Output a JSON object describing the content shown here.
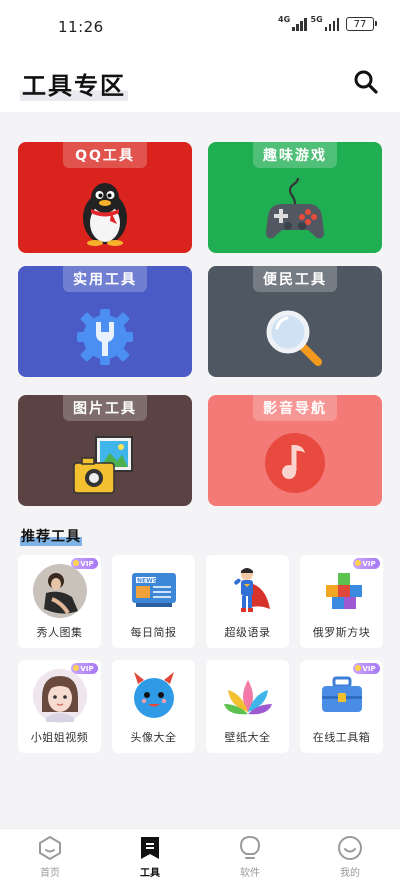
{
  "status": {
    "time": "11:26",
    "sig1": "4G",
    "sig2": "5G",
    "battery": "77"
  },
  "header": {
    "title": "工具专区"
  },
  "cards": [
    {
      "label": "QQ工具",
      "color": "#d9231c",
      "icon": "penguin-icon"
    },
    {
      "label": "趣味游戏",
      "color": "#1fae52",
      "icon": "gamepad-icon"
    },
    {
      "label": "实用工具",
      "color": "#4a5bc6",
      "icon": "settings-wrench-icon"
    },
    {
      "label": "便民工具",
      "color": "#4f5862",
      "icon": "magnifier-icon"
    },
    {
      "label": "图片工具",
      "color": "#5b4343",
      "icon": "camera-picture-icon"
    },
    {
      "label": "影音导航",
      "color": "#f47a78",
      "icon": "music-note-icon"
    }
  ],
  "recommend": {
    "title": "推荐工具",
    "items": [
      {
        "name": "秀人图集",
        "vip": "VIP",
        "icon": "photo-avatar-icon"
      },
      {
        "name": "每日简报",
        "vip": "",
        "icon": "news-board-icon"
      },
      {
        "name": "超级语录",
        "vip": "",
        "icon": "superhero-icon"
      },
      {
        "name": "俄罗斯方块",
        "vip": "VIP",
        "icon": "tetris-blocks-icon"
      },
      {
        "name": "小姐姐视频",
        "vip": "VIP",
        "icon": "girl-avatar-icon"
      },
      {
        "name": "头像大全",
        "vip": "",
        "icon": "blue-monster-icon"
      },
      {
        "name": "壁纸大全",
        "vip": "",
        "icon": "lotus-icon"
      },
      {
        "name": "在线工具箱",
        "vip": "VIP",
        "icon": "toolbox-icon"
      }
    ]
  },
  "tabs": [
    {
      "label": "首页",
      "icon": "home-icon",
      "active": false
    },
    {
      "label": "工具",
      "icon": "bookmark-tool-icon",
      "active": true
    },
    {
      "label": "软件",
      "icon": "bulb-icon",
      "active": false
    },
    {
      "label": "我的",
      "icon": "smile-icon",
      "active": false
    }
  ]
}
